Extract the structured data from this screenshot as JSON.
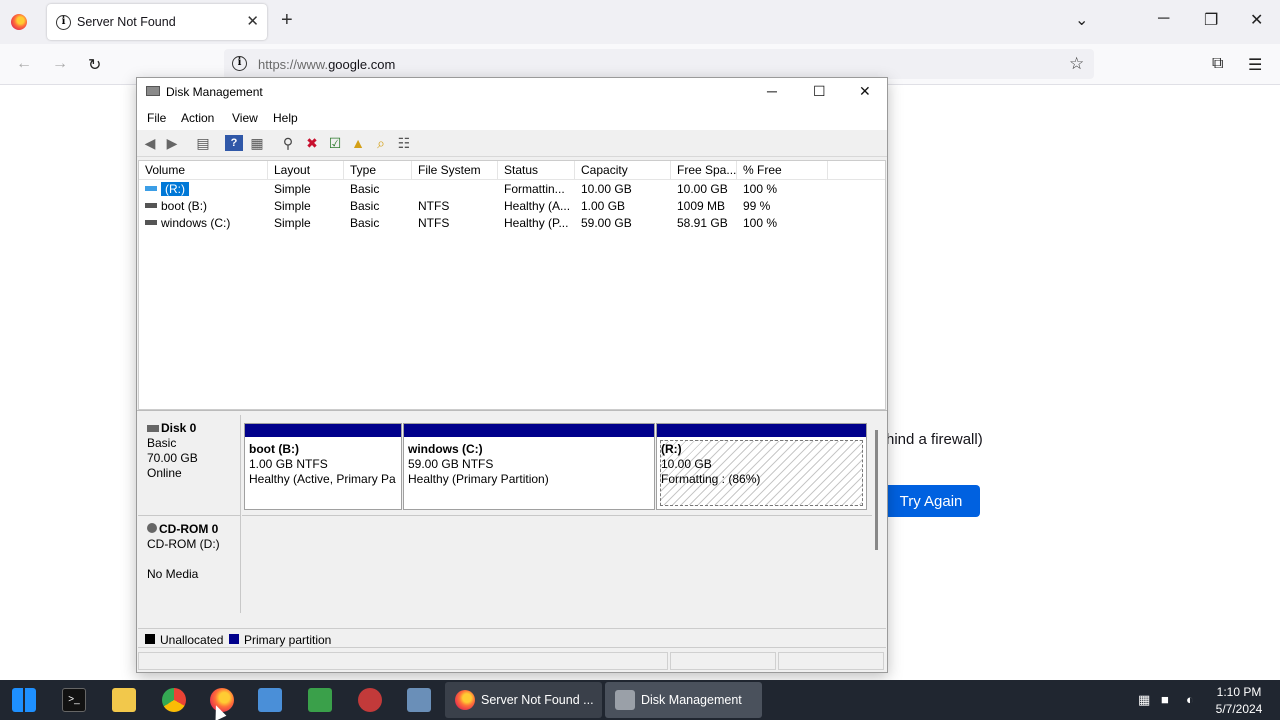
{
  "browser": {
    "tab_title": "Server Not Found",
    "tab_close": "✕",
    "new_tab": "+",
    "url_prefix": "https://www.",
    "url_domain": "google.com",
    "page_message_fragment": "hind a firewall)",
    "try_again_label": "Try Again"
  },
  "disk_mgmt": {
    "title": "Disk Management",
    "menu": [
      "File",
      "Action",
      "View",
      "Help"
    ],
    "columns": [
      "Volume",
      "Layout",
      "Type",
      "File System",
      "Status",
      "Capacity",
      "Free Spa...",
      "% Free"
    ],
    "volumes": [
      {
        "volume": "(R:)",
        "layout": "Simple",
        "type": "Basic",
        "fs": "",
        "status": "Formattin...",
        "capacity": "10.00 GB",
        "free": "10.00 GB",
        "pct": "100 %",
        "selected": true
      },
      {
        "volume": "boot (B:)",
        "layout": "Simple",
        "type": "Basic",
        "fs": "NTFS",
        "status": "Healthy (A...",
        "capacity": "1.00 GB",
        "free": "1009 MB",
        "pct": "99 %"
      },
      {
        "volume": "windows (C:)",
        "layout": "Simple",
        "type": "Basic",
        "fs": "NTFS",
        "status": "Healthy (P...",
        "capacity": "59.00 GB",
        "free": "58.91 GB",
        "pct": "100 %"
      }
    ],
    "disk0": {
      "name": "Disk 0",
      "type": "Basic",
      "size": "70.00 GB",
      "state": "Online",
      "partitions": [
        {
          "name": "boot  (B:)",
          "size": "1.00 GB NTFS",
          "status": "Healthy (Active, Primary Pa"
        },
        {
          "name": "windows  (C:)",
          "size": "59.00 GB NTFS",
          "status": "Healthy (Primary Partition)"
        },
        {
          "name": "(R:)",
          "size": "10.00 GB",
          "status": "Formatting : (86%)",
          "progress_pct": 86
        }
      ]
    },
    "cdrom": {
      "name": "CD-ROM 0",
      "drive": "CD-ROM (D:)",
      "media": "No Media"
    },
    "legend": [
      {
        "label": "Unallocated",
        "color": "#000000"
      },
      {
        "label": "Primary partition",
        "color": "#00008b"
      }
    ]
  },
  "taskbar": {
    "tasks": [
      {
        "label": "Server Not Found ...",
        "icon": "firefox-icon"
      },
      {
        "label": "Disk Management",
        "icon": "disk-management-icon"
      }
    ],
    "time": "1:10 PM",
    "date": "5/7/2024"
  },
  "colors": {
    "accent_blue": "#0061e0",
    "partition_bar": "#00008b",
    "selection": "#0078d7"
  }
}
